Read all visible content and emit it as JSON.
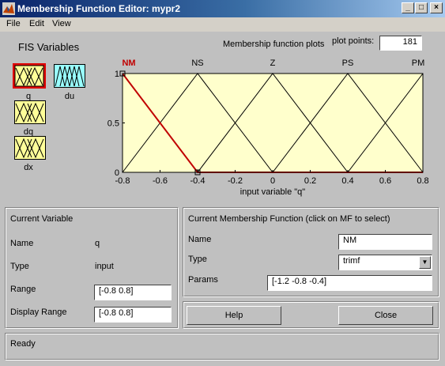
{
  "window": {
    "title": "Membership Function Editor: mypr2"
  },
  "menu": [
    "File",
    "Edit",
    "View"
  ],
  "fis_variables": {
    "heading": "FIS Variables",
    "inputs": [
      {
        "label": "q",
        "selected": true
      },
      {
        "label": "dq",
        "selected": false
      },
      {
        "label": "dx",
        "selected": false
      }
    ],
    "outputs": [
      {
        "label": "du"
      }
    ]
  },
  "plot": {
    "header": "Membership function plots",
    "plot_points_label": "plot points:",
    "plot_points_value": "181"
  },
  "chart_data": {
    "type": "line",
    "xlabel": "input variable \"q\"",
    "xlim": [
      -0.8,
      0.8
    ],
    "ylim": [
      0,
      1
    ],
    "xticks": [
      "-0.8",
      "-0.6",
      "-0.4",
      "-0.2",
      "0",
      "0.2",
      "0.4",
      "0.6",
      "0.8"
    ],
    "yticks": [
      "0",
      "0.5",
      "1"
    ],
    "series": [
      {
        "name": "NM",
        "params": [
          -1.2,
          -0.8,
          -0.4
        ],
        "selected": true
      },
      {
        "name": "NS",
        "params": [
          -0.8,
          -0.4,
          0.0
        ],
        "selected": false
      },
      {
        "name": "Z",
        "params": [
          -0.4,
          0.0,
          0.4
        ],
        "selected": false
      },
      {
        "name": "PS",
        "params": [
          0.0,
          0.4,
          0.8
        ],
        "selected": false
      },
      {
        "name": "PM",
        "params": [
          0.4,
          0.8,
          1.2
        ],
        "selected": false
      }
    ],
    "colors": {
      "background": "#ffffcc",
      "selected": "#c00000",
      "normal": "#000000"
    }
  },
  "current_variable": {
    "heading": "Current Variable",
    "name_label": "Name",
    "name_value": "q",
    "type_label": "Type",
    "type_value": "input",
    "range_label": "Range",
    "range_value": "[-0.8 0.8]",
    "display_range_label": "Display Range",
    "display_range_value": "[-0.8 0.8]"
  },
  "current_mf": {
    "heading": "Current Membership Function (click on MF to select)",
    "name_label": "Name",
    "name_value": "NM",
    "type_label": "Type",
    "type_value": "trimf",
    "params_label": "Params",
    "params_value": "[-1.2 -0.8 -0.4]"
  },
  "buttons": {
    "help": "Help",
    "close": "Close"
  },
  "status": "Ready"
}
